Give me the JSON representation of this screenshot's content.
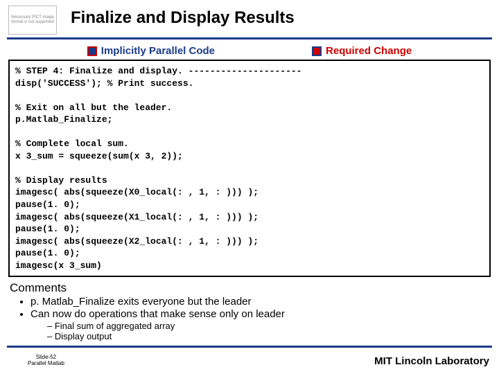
{
  "placeholder_text": "Necessary PICT image format is not supported",
  "title": "Finalize and Display Results",
  "legend": {
    "parallel": "Implicitly Parallel Code",
    "required": "Required Change"
  },
  "code": "% STEP 4: Finalize and display. ---------------------\ndisp('SUCCESS'); % Print success.\n\n% Exit on all but the leader.\np.Matlab_Finalize;\n\n% Complete local sum.\nx 3_sum = squeeze(sum(x 3, 2));\n\n% Display results\nimagesc( abs(squeeze(X0_local(: , 1, : ))) );\npause(1. 0);\nimagesc( abs(squeeze(X1_local(: , 1, : ))) );\npause(1. 0);\nimagesc( abs(squeeze(X2_local(: , 1, : ))) );\npause(1. 0);\nimagesc(x 3_sum)",
  "comments": {
    "heading": "Comments",
    "bullets": [
      "p. Matlab_Finalize exits everyone but the leader",
      "Can now do operations that make sense only on leader"
    ],
    "dashes": [
      "Final sum of aggregated array",
      "Display output"
    ]
  },
  "footer": {
    "slide": "Slide-52",
    "sub": "Parallel Matlab",
    "org": "MIT Lincoln Laboratory"
  }
}
